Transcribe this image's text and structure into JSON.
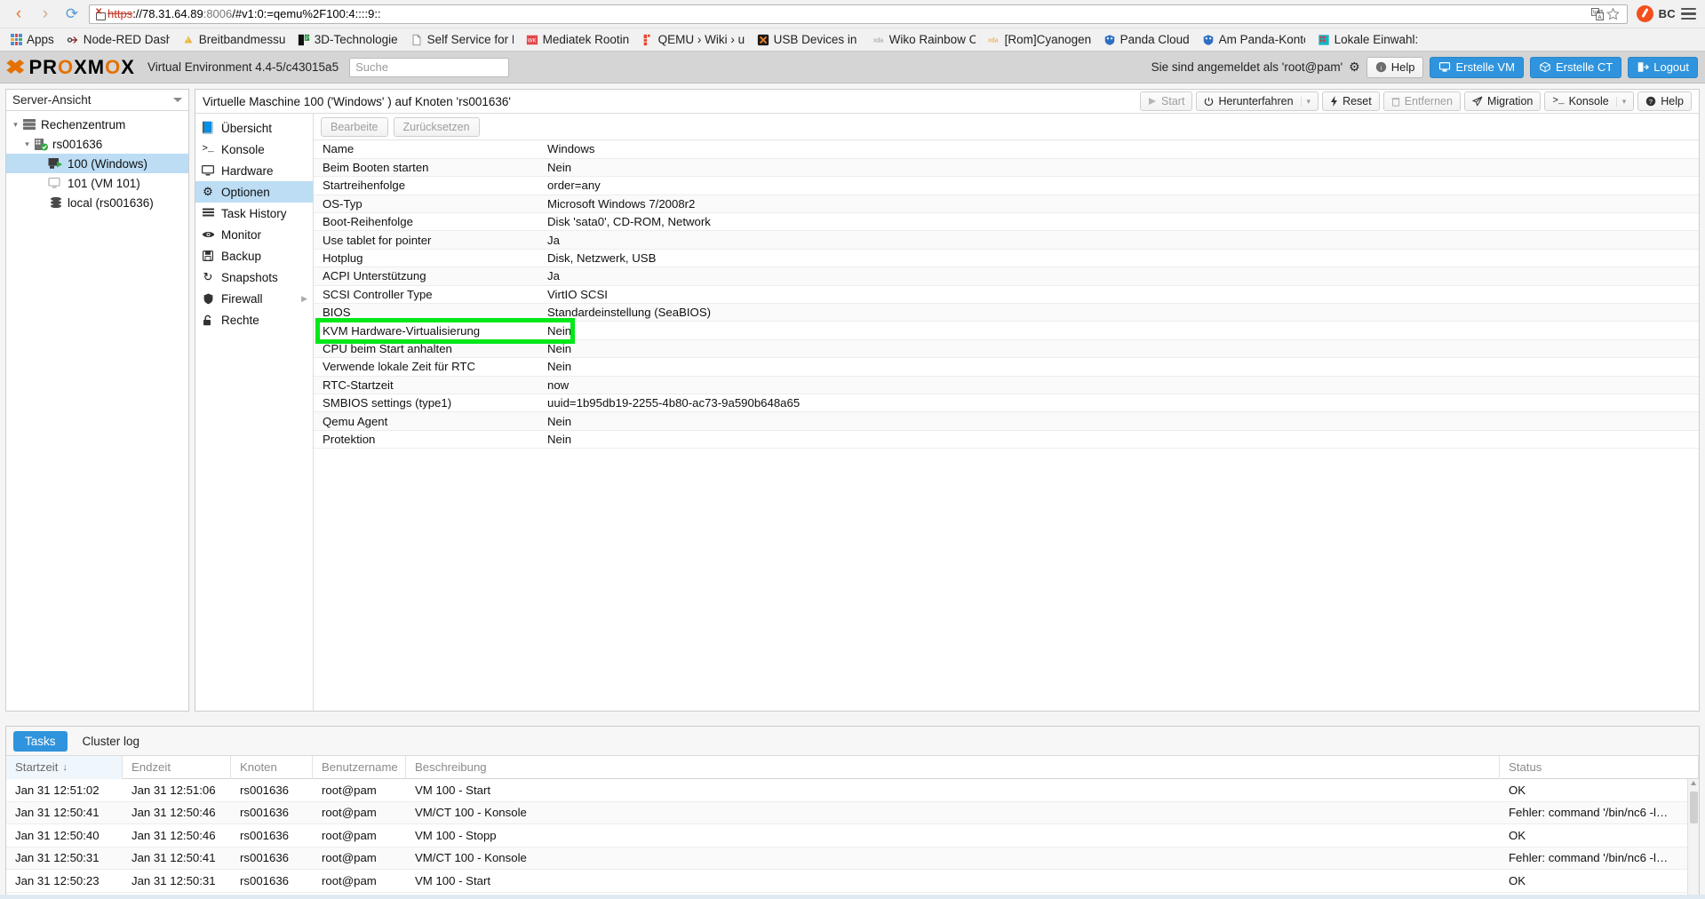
{
  "browser": {
    "nav": {
      "back": "‹",
      "forward": "›",
      "reload": "⟳"
    },
    "url": {
      "scheme": "https",
      "separator": "://",
      "host": "78.31.64.89",
      "port": ":8006",
      "path": "/#v1:0:=qemu%2F100:4::::9::",
      "full": "https://78.31.64.89:8006/#v1:0:=qemu%2F100:4::::9::"
    },
    "translate_icon": "translate-icon",
    "bookmark_star_icon": "star-icon",
    "profile_label": "BC",
    "menu_icon": "hamburger-menu-icon",
    "bookmarks": [
      {
        "label": "Apps",
        "icon": "apps-grid-icon"
      },
      {
        "label": "Node-RED Dashb",
        "icon": "node-red-icon"
      },
      {
        "label": "Breitbandmessu",
        "icon": "generic-page-icon"
      },
      {
        "label": "3D-Technologie",
        "icon": "tp-icon"
      },
      {
        "label": "Self Service for N",
        "icon": "document-icon"
      },
      {
        "label": "Mediatek Rooting",
        "icon": "wiki-red-icon"
      },
      {
        "label": "QEMU › Wiki › ub",
        "icon": "qemu-icon"
      },
      {
        "label": "USB Devices in V",
        "icon": "virtualbox-icon"
      },
      {
        "label": "Wiko Rainbow Cy",
        "icon": "xda-icon"
      },
      {
        "label": "[Rom]Cyanogenm",
        "icon": "xda-icon"
      },
      {
        "label": "Panda Cloud",
        "icon": "panda-shield-icon"
      },
      {
        "label": "Am Panda-Konto",
        "icon": "panda-shield-icon"
      },
      {
        "label": "Lokale Einwahl:",
        "icon": "film-icon"
      }
    ]
  },
  "pve": {
    "logo_x": "X",
    "logo_text_parts": [
      "PR",
      "O",
      "XM",
      "O",
      "X"
    ],
    "logo_text": "PROXMOX",
    "version": "Virtual Environment 4.4-5/c43015a5",
    "search_placeholder": "Suche",
    "search_value": "",
    "login_status": "Sie sind angemeldet als 'root@pam'",
    "gear_icon": "gear-icon",
    "header_buttons": [
      {
        "label": "Help",
        "icon": "info-circle-icon",
        "style": "default"
      },
      {
        "label": "Erstelle VM",
        "icon": "monitor-icon",
        "style": "primary"
      },
      {
        "label": "Erstelle CT",
        "icon": "box-icon",
        "style": "primary"
      },
      {
        "label": "Logout",
        "icon": "logout-icon",
        "style": "primary"
      }
    ]
  },
  "sidebar": {
    "view_label": "Server-Ansicht",
    "view_caret_icon": "chevron-down-icon",
    "tree": [
      {
        "label": "Rechenzentrum",
        "icon": "datacenter-icon",
        "indent": 0,
        "expander": "⌄",
        "selected": false
      },
      {
        "label": "rs001636",
        "icon": "node-online-icon",
        "indent": 1,
        "expander": "⌄",
        "selected": false
      },
      {
        "label": "100 (Windows)",
        "icon": "vm-running-icon",
        "indent": 2,
        "expander": "",
        "selected": true
      },
      {
        "label": "101 (VM 101)",
        "icon": "vm-stopped-icon",
        "indent": 2,
        "expander": "",
        "selected": false
      },
      {
        "label": "local (rs001636)",
        "icon": "storage-icon",
        "indent": 2,
        "expander": "",
        "selected": false
      }
    ]
  },
  "content": {
    "title": "Virtuelle Maschine 100 ('Windows' ) auf Knoten 'rs001636'",
    "vm_toolbar": [
      {
        "label": "Start",
        "icon": "play-icon",
        "disabled": true,
        "split": false
      },
      {
        "label": "Herunterfahren",
        "icon": "power-icon",
        "disabled": false,
        "split": true
      },
      {
        "label": "Reset",
        "icon": "bolt-icon",
        "disabled": false,
        "split": false
      },
      {
        "label": "Entfernen",
        "icon": "trash-icon",
        "disabled": true,
        "split": false
      },
      {
        "label": "Migration",
        "icon": "paper-plane-icon",
        "disabled": false,
        "split": false
      },
      {
        "label": "Konsole",
        "icon": "terminal-icon",
        "disabled": false,
        "split": true
      },
      {
        "label": "Help",
        "icon": "question-circle-icon",
        "disabled": false,
        "split": false
      }
    ],
    "vtabs": [
      {
        "label": "Übersicht",
        "icon": "book-icon",
        "active": false,
        "arrow": false
      },
      {
        "label": "Konsole",
        "icon": "terminal-icon",
        "active": false,
        "arrow": false
      },
      {
        "label": "Hardware",
        "icon": "monitor-icon",
        "active": false,
        "arrow": false
      },
      {
        "label": "Optionen",
        "icon": "gear-icon",
        "active": true,
        "arrow": false
      },
      {
        "label": "Task History",
        "icon": "list-icon",
        "active": false,
        "arrow": false
      },
      {
        "label": "Monitor",
        "icon": "eye-icon",
        "active": false,
        "arrow": false
      },
      {
        "label": "Backup",
        "icon": "floppy-icon",
        "active": false,
        "arrow": false
      },
      {
        "label": "Snapshots",
        "icon": "history-icon",
        "active": false,
        "arrow": false
      },
      {
        "label": "Firewall",
        "icon": "shield-icon",
        "active": false,
        "arrow": true
      },
      {
        "label": "Rechte",
        "icon": "unlock-icon",
        "active": false,
        "arrow": false
      }
    ],
    "options_toolbar": [
      {
        "label": "Bearbeite",
        "disabled": true
      },
      {
        "label": "Zurücksetzen",
        "disabled": true
      }
    ],
    "options_rows": [
      {
        "key": "Name",
        "value": "Windows"
      },
      {
        "key": "Beim Booten starten",
        "value": "Nein"
      },
      {
        "key": "Startreihenfolge",
        "value": "order=any"
      },
      {
        "key": "OS-Typ",
        "value": "Microsoft Windows 7/2008r2"
      },
      {
        "key": "Boot-Reihenfolge",
        "value": "Disk 'sata0', CD-ROM, Network"
      },
      {
        "key": "Use tablet for pointer",
        "value": "Ja"
      },
      {
        "key": "Hotplug",
        "value": "Disk, Netzwerk, USB"
      },
      {
        "key": "ACPI Unterstützung",
        "value": "Ja"
      },
      {
        "key": "SCSI Controller Type",
        "value": "VirtIO SCSI"
      },
      {
        "key": "BIOS",
        "value": "Standardeinstellung (SeaBIOS)"
      },
      {
        "key": "KVM Hardware-Virtualisierung",
        "value": "Nein"
      },
      {
        "key": "CPU beim Start anhalten",
        "value": "Nein"
      },
      {
        "key": "Verwende lokale Zeit für RTC",
        "value": "Nein"
      },
      {
        "key": "RTC-Startzeit",
        "value": "now"
      },
      {
        "key": "SMBIOS settings (type1)",
        "value": "uuid=1b95db19-2255-4b80-ac73-9a590b648a65"
      },
      {
        "key": "Qemu Agent",
        "value": "Nein"
      },
      {
        "key": "Protektion",
        "value": "Nein"
      }
    ],
    "highlight": {
      "color": "#00e818",
      "target_row": "KVM Hardware-Virtualisierung"
    }
  },
  "tasks": {
    "tabs": [
      {
        "label": "Tasks",
        "active": true
      },
      {
        "label": "Cluster log",
        "active": false
      }
    ],
    "columns": [
      "Startzeit",
      "Endzeit",
      "Knoten",
      "Benutzername",
      "Beschreibung",
      "Status"
    ],
    "sort_column": "Startzeit",
    "sort_arrow": "↓",
    "rows": [
      {
        "start": "Jan 31 12:51:02",
        "end": "Jan 31 12:51:06",
        "node": "rs001636",
        "user": "root@pam",
        "desc": "VM 100 - Start",
        "status": "OK"
      },
      {
        "start": "Jan 31 12:50:41",
        "end": "Jan 31 12:50:46",
        "node": "rs001636",
        "user": "root@pam",
        "desc": "VM/CT 100 - Konsole",
        "status": "Fehler: command '/bin/nc6 -l…"
      },
      {
        "start": "Jan 31 12:50:40",
        "end": "Jan 31 12:50:46",
        "node": "rs001636",
        "user": "root@pam",
        "desc": "VM 100 - Stopp",
        "status": "OK"
      },
      {
        "start": "Jan 31 12:50:31",
        "end": "Jan 31 12:50:41",
        "node": "rs001636",
        "user": "root@pam",
        "desc": "VM/CT 100 - Konsole",
        "status": "Fehler: command '/bin/nc6 -l…"
      },
      {
        "start": "Jan 31 12:50:23",
        "end": "Jan 31 12:50:31",
        "node": "rs001636",
        "user": "root@pam",
        "desc": "VM 100 - Start",
        "status": "OK"
      }
    ]
  },
  "colors": {
    "accent_blue": "#2f94dd",
    "selection_blue": "#bcddf4",
    "proxmox_orange": "#e57000",
    "highlight_green": "#00e818",
    "header_gray": "#d5d5d5"
  }
}
